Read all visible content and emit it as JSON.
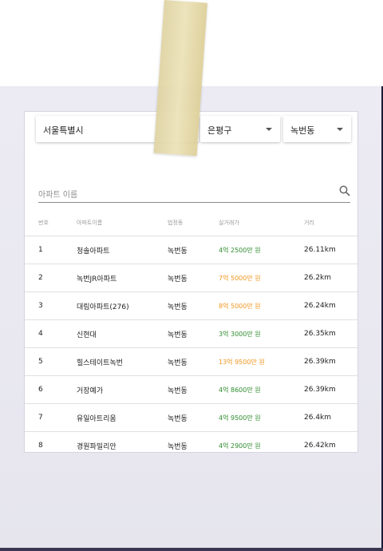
{
  "filters": {
    "city": "서울특별시",
    "district": "은평구",
    "dong": "녹번동"
  },
  "search": {
    "placeholder": "아파트 이름",
    "icon": "search-icon"
  },
  "table": {
    "headers": [
      "번호",
      "아파트이름",
      "법정동",
      "실거래가",
      "거리"
    ],
    "rows": [
      {
        "no": "1",
        "name": "청솔아파트",
        "dong": "녹번동",
        "price": "4억 2500만 원",
        "dist": "26.11km",
        "price_color": "#2e8b2e"
      },
      {
        "no": "2",
        "name": "녹번JR아파트",
        "dong": "녹번동",
        "price": "7억 5000만 원",
        "dist": "26.2km",
        "price_color": "#f0961e"
      },
      {
        "no": "3",
        "name": "대림아파트(276)",
        "dong": "녹번동",
        "price": "8억 5000만 원",
        "dist": "26.24km",
        "price_color": "#f0961e"
      },
      {
        "no": "4",
        "name": "신현대",
        "dong": "녹번동",
        "price": "3억 3000만 원",
        "dist": "26.35km",
        "price_color": "#2e8b2e"
      },
      {
        "no": "5",
        "name": "힐스테이트녹번",
        "dong": "녹번동",
        "price": "13억 9500만 원",
        "dist": "26.39km",
        "price_color": "#f0961e"
      },
      {
        "no": "6",
        "name": "거장예가",
        "dong": "녹번동",
        "price": "4억 8600만 원",
        "dist": "26.39km",
        "price_color": "#2e8b2e"
      },
      {
        "no": "7",
        "name": "유일아트리움",
        "dong": "녹번동",
        "price": "4억 9500만 원",
        "dist": "26.4km",
        "price_color": "#2e8b2e"
      },
      {
        "no": "8",
        "name": "경원파밀리안",
        "dong": "녹번동",
        "price": "4억 2900만 원",
        "dist": "26.42km",
        "price_color": "#2e8b2e"
      }
    ]
  },
  "colors": {
    "cheap": "#2e8b2e",
    "expensive": "#f0961e"
  }
}
